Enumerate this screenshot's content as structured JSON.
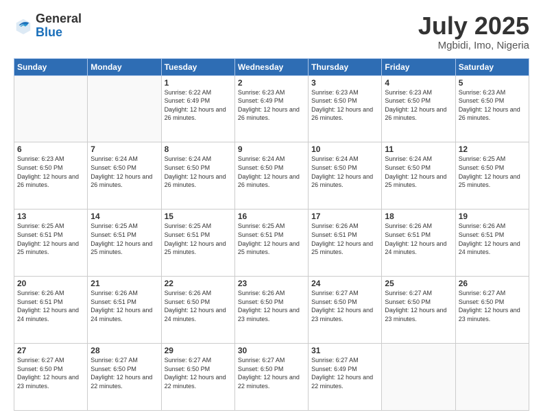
{
  "header": {
    "logo_general": "General",
    "logo_blue": "Blue",
    "month_title": "July 2025",
    "location": "Mgbidi, Imo, Nigeria"
  },
  "weekdays": [
    "Sunday",
    "Monday",
    "Tuesday",
    "Wednesday",
    "Thursday",
    "Friday",
    "Saturday"
  ],
  "weeks": [
    [
      {
        "day": "",
        "sunrise": "",
        "sunset": "",
        "daylight": ""
      },
      {
        "day": "",
        "sunrise": "",
        "sunset": "",
        "daylight": ""
      },
      {
        "day": "1",
        "sunrise": "Sunrise: 6:22 AM",
        "sunset": "Sunset: 6:49 PM",
        "daylight": "Daylight: 12 hours and 26 minutes."
      },
      {
        "day": "2",
        "sunrise": "Sunrise: 6:23 AM",
        "sunset": "Sunset: 6:49 PM",
        "daylight": "Daylight: 12 hours and 26 minutes."
      },
      {
        "day": "3",
        "sunrise": "Sunrise: 6:23 AM",
        "sunset": "Sunset: 6:50 PM",
        "daylight": "Daylight: 12 hours and 26 minutes."
      },
      {
        "day": "4",
        "sunrise": "Sunrise: 6:23 AM",
        "sunset": "Sunset: 6:50 PM",
        "daylight": "Daylight: 12 hours and 26 minutes."
      },
      {
        "day": "5",
        "sunrise": "Sunrise: 6:23 AM",
        "sunset": "Sunset: 6:50 PM",
        "daylight": "Daylight: 12 hours and 26 minutes."
      }
    ],
    [
      {
        "day": "6",
        "sunrise": "Sunrise: 6:23 AM",
        "sunset": "Sunset: 6:50 PM",
        "daylight": "Daylight: 12 hours and 26 minutes."
      },
      {
        "day": "7",
        "sunrise": "Sunrise: 6:24 AM",
        "sunset": "Sunset: 6:50 PM",
        "daylight": "Daylight: 12 hours and 26 minutes."
      },
      {
        "day": "8",
        "sunrise": "Sunrise: 6:24 AM",
        "sunset": "Sunset: 6:50 PM",
        "daylight": "Daylight: 12 hours and 26 minutes."
      },
      {
        "day": "9",
        "sunrise": "Sunrise: 6:24 AM",
        "sunset": "Sunset: 6:50 PM",
        "daylight": "Daylight: 12 hours and 26 minutes."
      },
      {
        "day": "10",
        "sunrise": "Sunrise: 6:24 AM",
        "sunset": "Sunset: 6:50 PM",
        "daylight": "Daylight: 12 hours and 26 minutes."
      },
      {
        "day": "11",
        "sunrise": "Sunrise: 6:24 AM",
        "sunset": "Sunset: 6:50 PM",
        "daylight": "Daylight: 12 hours and 25 minutes."
      },
      {
        "day": "12",
        "sunrise": "Sunrise: 6:25 AM",
        "sunset": "Sunset: 6:50 PM",
        "daylight": "Daylight: 12 hours and 25 minutes."
      }
    ],
    [
      {
        "day": "13",
        "sunrise": "Sunrise: 6:25 AM",
        "sunset": "Sunset: 6:51 PM",
        "daylight": "Daylight: 12 hours and 25 minutes."
      },
      {
        "day": "14",
        "sunrise": "Sunrise: 6:25 AM",
        "sunset": "Sunset: 6:51 PM",
        "daylight": "Daylight: 12 hours and 25 minutes."
      },
      {
        "day": "15",
        "sunrise": "Sunrise: 6:25 AM",
        "sunset": "Sunset: 6:51 PM",
        "daylight": "Daylight: 12 hours and 25 minutes."
      },
      {
        "day": "16",
        "sunrise": "Sunrise: 6:25 AM",
        "sunset": "Sunset: 6:51 PM",
        "daylight": "Daylight: 12 hours and 25 minutes."
      },
      {
        "day": "17",
        "sunrise": "Sunrise: 6:26 AM",
        "sunset": "Sunset: 6:51 PM",
        "daylight": "Daylight: 12 hours and 25 minutes."
      },
      {
        "day": "18",
        "sunrise": "Sunrise: 6:26 AM",
        "sunset": "Sunset: 6:51 PM",
        "daylight": "Daylight: 12 hours and 24 minutes."
      },
      {
        "day": "19",
        "sunrise": "Sunrise: 6:26 AM",
        "sunset": "Sunset: 6:51 PM",
        "daylight": "Daylight: 12 hours and 24 minutes."
      }
    ],
    [
      {
        "day": "20",
        "sunrise": "Sunrise: 6:26 AM",
        "sunset": "Sunset: 6:51 PM",
        "daylight": "Daylight: 12 hours and 24 minutes."
      },
      {
        "day": "21",
        "sunrise": "Sunrise: 6:26 AM",
        "sunset": "Sunset: 6:51 PM",
        "daylight": "Daylight: 12 hours and 24 minutes."
      },
      {
        "day": "22",
        "sunrise": "Sunrise: 6:26 AM",
        "sunset": "Sunset: 6:50 PM",
        "daylight": "Daylight: 12 hours and 24 minutes."
      },
      {
        "day": "23",
        "sunrise": "Sunrise: 6:26 AM",
        "sunset": "Sunset: 6:50 PM",
        "daylight": "Daylight: 12 hours and 23 minutes."
      },
      {
        "day": "24",
        "sunrise": "Sunrise: 6:27 AM",
        "sunset": "Sunset: 6:50 PM",
        "daylight": "Daylight: 12 hours and 23 minutes."
      },
      {
        "day": "25",
        "sunrise": "Sunrise: 6:27 AM",
        "sunset": "Sunset: 6:50 PM",
        "daylight": "Daylight: 12 hours and 23 minutes."
      },
      {
        "day": "26",
        "sunrise": "Sunrise: 6:27 AM",
        "sunset": "Sunset: 6:50 PM",
        "daylight": "Daylight: 12 hours and 23 minutes."
      }
    ],
    [
      {
        "day": "27",
        "sunrise": "Sunrise: 6:27 AM",
        "sunset": "Sunset: 6:50 PM",
        "daylight": "Daylight: 12 hours and 23 minutes."
      },
      {
        "day": "28",
        "sunrise": "Sunrise: 6:27 AM",
        "sunset": "Sunset: 6:50 PM",
        "daylight": "Daylight: 12 hours and 22 minutes."
      },
      {
        "day": "29",
        "sunrise": "Sunrise: 6:27 AM",
        "sunset": "Sunset: 6:50 PM",
        "daylight": "Daylight: 12 hours and 22 minutes."
      },
      {
        "day": "30",
        "sunrise": "Sunrise: 6:27 AM",
        "sunset": "Sunset: 6:50 PM",
        "daylight": "Daylight: 12 hours and 22 minutes."
      },
      {
        "day": "31",
        "sunrise": "Sunrise: 6:27 AM",
        "sunset": "Sunset: 6:49 PM",
        "daylight": "Daylight: 12 hours and 22 minutes."
      },
      {
        "day": "",
        "sunrise": "",
        "sunset": "",
        "daylight": ""
      },
      {
        "day": "",
        "sunrise": "",
        "sunset": "",
        "daylight": ""
      }
    ]
  ]
}
